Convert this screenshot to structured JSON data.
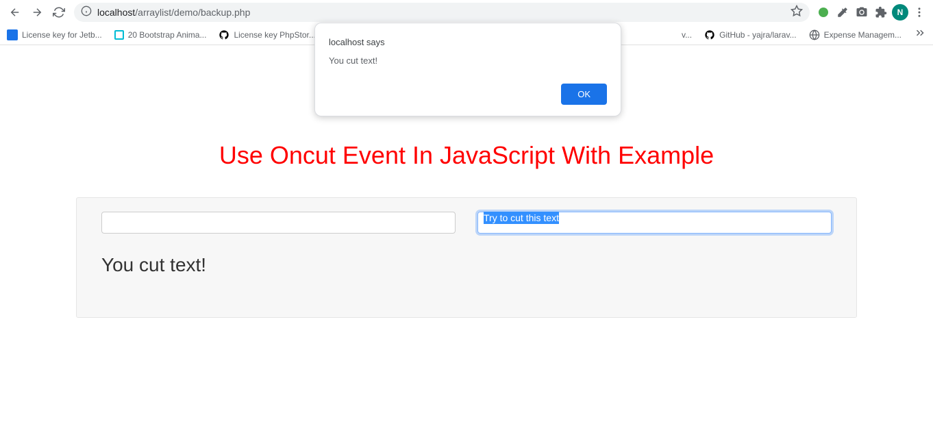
{
  "toolbar": {
    "url_host": "localhost",
    "url_path": "/arraylist/demo/backup.php",
    "profile_letter": "N"
  },
  "bookmarks": {
    "items": [
      {
        "label": "License key for Jetb..."
      },
      {
        "label": "20 Bootstrap Anima..."
      },
      {
        "label": "License key PhpStor..."
      },
      {
        "label": "v..."
      },
      {
        "label": "GitHub - yajra/larav..."
      },
      {
        "label": "Expense Managem..."
      }
    ]
  },
  "dialog": {
    "title": "localhost says",
    "message": "You cut text!",
    "ok_label": "OK"
  },
  "page": {
    "heading": "Use Oncut Event In JavaScript With Example",
    "input1_value": "",
    "input2_value": "Try to cut this text",
    "result": "You cut text!"
  }
}
